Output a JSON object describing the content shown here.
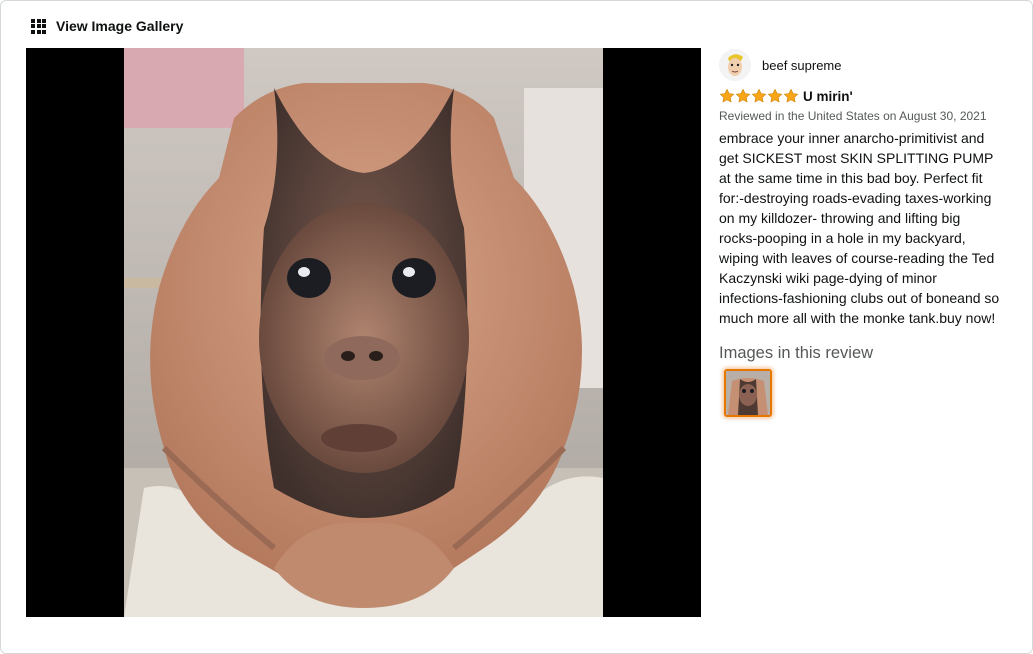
{
  "header": {
    "gallery_link_label": "View Image Gallery",
    "gallery_icon": "grid-icon"
  },
  "review": {
    "reviewer_name": "beef supreme",
    "avatar": "cartoon-avatar",
    "rating": 5,
    "rating_max": 5,
    "title": "U mirin'",
    "meta": "Reviewed in the United States on August 30, 2021",
    "body": "embrace your inner anarcho-primitivist and get SICKEST most SKIN SPLITTING PUMP at the same time in this bad boy. Perfect fit for:-destroying roads-evading taxes-working on my killdozer- throwing and lifting big rocks-pooping in a hole in my backyard, wiping with leaves of course-reading the Ted Kaczynski wiki page-dying of minor infections-fashioning clubs out of boneand so much more all with the monke tank.buy now!",
    "images_heading": "Images in this review",
    "thumbnail_count": 1
  },
  "colors": {
    "star": "#f8a617",
    "thumb_border": "#e77600",
    "viewer_bg": "#000000"
  }
}
